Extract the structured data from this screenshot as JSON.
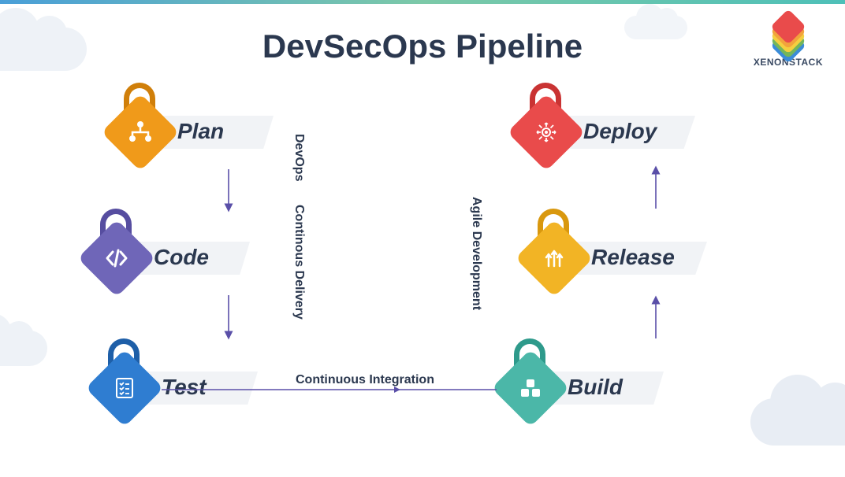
{
  "title": "DevSecOps Pipeline",
  "brand": "XENONSTACK",
  "logo_colors": [
    "#e94b4b",
    "#f2a33c",
    "#f4cf3f",
    "#74b65a",
    "#3a8bd8"
  ],
  "stages": {
    "plan": {
      "label": "Plan",
      "color": "#f09a1a",
      "shackle": "#d07f0a",
      "glyph": "hierarchy"
    },
    "code": {
      "label": "Code",
      "color": "#6f66b8",
      "shackle": "#564da0",
      "glyph": "code"
    },
    "test": {
      "label": "Test",
      "color": "#2f7dd1",
      "shackle": "#1e5fa8",
      "glyph": "checklist"
    },
    "build": {
      "label": "Build",
      "color": "#4bb7a8",
      "shackle": "#2e9a8b",
      "glyph": "blocks"
    },
    "release": {
      "label": "Release",
      "color": "#f2b425",
      "shackle": "#d9980e",
      "glyph": "arrows-up"
    },
    "deploy": {
      "label": "Deploy",
      "color": "#e94b4b",
      "shackle": "#c93333",
      "glyph": "gear-expand"
    }
  },
  "flow_labels": {
    "devops": "DevOps",
    "cd": "Continous Delivery",
    "ci": "Continuous Integration",
    "agile": "Agile Development"
  },
  "arrow_color": "#5a4fa8"
}
